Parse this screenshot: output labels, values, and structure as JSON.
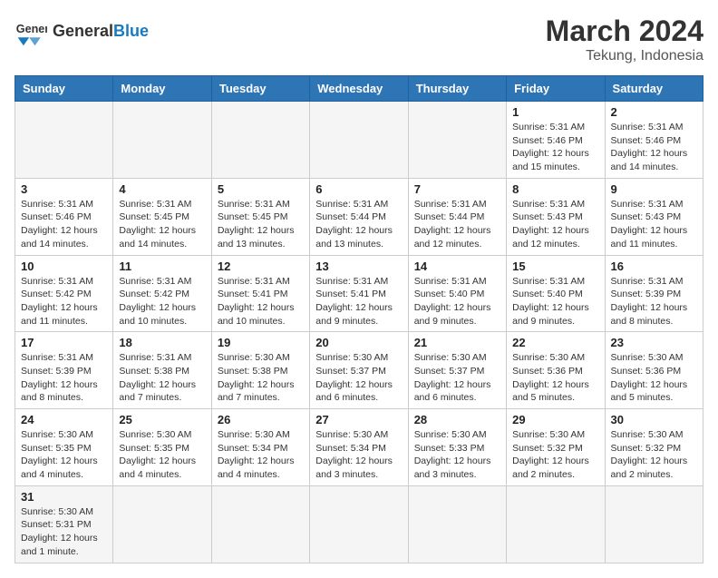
{
  "header": {
    "logo_general": "General",
    "logo_blue": "Blue",
    "title": "March 2024",
    "subtitle": "Tekung, Indonesia"
  },
  "days_of_week": [
    "Sunday",
    "Monday",
    "Tuesday",
    "Wednesday",
    "Thursday",
    "Friday",
    "Saturday"
  ],
  "weeks": [
    [
      {
        "day": "",
        "info": ""
      },
      {
        "day": "",
        "info": ""
      },
      {
        "day": "",
        "info": ""
      },
      {
        "day": "",
        "info": ""
      },
      {
        "day": "",
        "info": ""
      },
      {
        "day": "1",
        "info": "Sunrise: 5:31 AM\nSunset: 5:46 PM\nDaylight: 12 hours and 15 minutes."
      },
      {
        "day": "2",
        "info": "Sunrise: 5:31 AM\nSunset: 5:46 PM\nDaylight: 12 hours and 14 minutes."
      }
    ],
    [
      {
        "day": "3",
        "info": "Sunrise: 5:31 AM\nSunset: 5:46 PM\nDaylight: 12 hours and 14 minutes."
      },
      {
        "day": "4",
        "info": "Sunrise: 5:31 AM\nSunset: 5:45 PM\nDaylight: 12 hours and 14 minutes."
      },
      {
        "day": "5",
        "info": "Sunrise: 5:31 AM\nSunset: 5:45 PM\nDaylight: 12 hours and 13 minutes."
      },
      {
        "day": "6",
        "info": "Sunrise: 5:31 AM\nSunset: 5:44 PM\nDaylight: 12 hours and 13 minutes."
      },
      {
        "day": "7",
        "info": "Sunrise: 5:31 AM\nSunset: 5:44 PM\nDaylight: 12 hours and 12 minutes."
      },
      {
        "day": "8",
        "info": "Sunrise: 5:31 AM\nSunset: 5:43 PM\nDaylight: 12 hours and 12 minutes."
      },
      {
        "day": "9",
        "info": "Sunrise: 5:31 AM\nSunset: 5:43 PM\nDaylight: 12 hours and 11 minutes."
      }
    ],
    [
      {
        "day": "10",
        "info": "Sunrise: 5:31 AM\nSunset: 5:42 PM\nDaylight: 12 hours and 11 minutes."
      },
      {
        "day": "11",
        "info": "Sunrise: 5:31 AM\nSunset: 5:42 PM\nDaylight: 12 hours and 10 minutes."
      },
      {
        "day": "12",
        "info": "Sunrise: 5:31 AM\nSunset: 5:41 PM\nDaylight: 12 hours and 10 minutes."
      },
      {
        "day": "13",
        "info": "Sunrise: 5:31 AM\nSunset: 5:41 PM\nDaylight: 12 hours and 9 minutes."
      },
      {
        "day": "14",
        "info": "Sunrise: 5:31 AM\nSunset: 5:40 PM\nDaylight: 12 hours and 9 minutes."
      },
      {
        "day": "15",
        "info": "Sunrise: 5:31 AM\nSunset: 5:40 PM\nDaylight: 12 hours and 9 minutes."
      },
      {
        "day": "16",
        "info": "Sunrise: 5:31 AM\nSunset: 5:39 PM\nDaylight: 12 hours and 8 minutes."
      }
    ],
    [
      {
        "day": "17",
        "info": "Sunrise: 5:31 AM\nSunset: 5:39 PM\nDaylight: 12 hours and 8 minutes."
      },
      {
        "day": "18",
        "info": "Sunrise: 5:31 AM\nSunset: 5:38 PM\nDaylight: 12 hours and 7 minutes."
      },
      {
        "day": "19",
        "info": "Sunrise: 5:30 AM\nSunset: 5:38 PM\nDaylight: 12 hours and 7 minutes."
      },
      {
        "day": "20",
        "info": "Sunrise: 5:30 AM\nSunset: 5:37 PM\nDaylight: 12 hours and 6 minutes."
      },
      {
        "day": "21",
        "info": "Sunrise: 5:30 AM\nSunset: 5:37 PM\nDaylight: 12 hours and 6 minutes."
      },
      {
        "day": "22",
        "info": "Sunrise: 5:30 AM\nSunset: 5:36 PM\nDaylight: 12 hours and 5 minutes."
      },
      {
        "day": "23",
        "info": "Sunrise: 5:30 AM\nSunset: 5:36 PM\nDaylight: 12 hours and 5 minutes."
      }
    ],
    [
      {
        "day": "24",
        "info": "Sunrise: 5:30 AM\nSunset: 5:35 PM\nDaylight: 12 hours and 4 minutes."
      },
      {
        "day": "25",
        "info": "Sunrise: 5:30 AM\nSunset: 5:35 PM\nDaylight: 12 hours and 4 minutes."
      },
      {
        "day": "26",
        "info": "Sunrise: 5:30 AM\nSunset: 5:34 PM\nDaylight: 12 hours and 4 minutes."
      },
      {
        "day": "27",
        "info": "Sunrise: 5:30 AM\nSunset: 5:34 PM\nDaylight: 12 hours and 3 minutes."
      },
      {
        "day": "28",
        "info": "Sunrise: 5:30 AM\nSunset: 5:33 PM\nDaylight: 12 hours and 3 minutes."
      },
      {
        "day": "29",
        "info": "Sunrise: 5:30 AM\nSunset: 5:32 PM\nDaylight: 12 hours and 2 minutes."
      },
      {
        "day": "30",
        "info": "Sunrise: 5:30 AM\nSunset: 5:32 PM\nDaylight: 12 hours and 2 minutes."
      }
    ],
    [
      {
        "day": "31",
        "info": "Sunrise: 5:30 AM\nSunset: 5:31 PM\nDaylight: 12 hours and 1 minute."
      },
      {
        "day": "",
        "info": ""
      },
      {
        "day": "",
        "info": ""
      },
      {
        "day": "",
        "info": ""
      },
      {
        "day": "",
        "info": ""
      },
      {
        "day": "",
        "info": ""
      },
      {
        "day": "",
        "info": ""
      }
    ]
  ]
}
